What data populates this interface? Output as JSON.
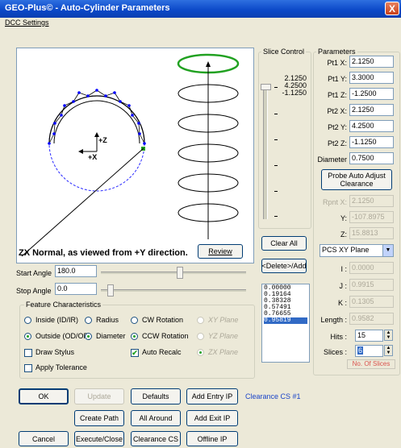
{
  "window": {
    "title": "GEO-Plus© - Auto-Cylinder Parameters",
    "close": "X"
  },
  "menu": {
    "dcc_settings": "DCC Settings"
  },
  "view": {
    "caption": "ZX Normal, as viewed from +Y direction.",
    "axis_z": "+Z",
    "axis_x": "+X",
    "review": "Review"
  },
  "angles": {
    "start_label": "Start Angle",
    "start_value": "180.0",
    "stop_label": "Stop Angle",
    "stop_value": "0.0"
  },
  "feature": {
    "title": "Feature Characteristics",
    "inside": "Inside (ID/IR)",
    "radius": "Radius",
    "cw": "CW Rotation",
    "xy_plane": "XY Plane",
    "outside": "Outside (OD/OR)",
    "diameter": "Diameter",
    "ccw": "CCW Rotation",
    "yz_plane": "YZ Plane",
    "draw_stylus": "Draw Stylus",
    "auto_recalc": "Auto Recalc",
    "zx_plane": "ZX Plane",
    "apply_tolerance": "Apply Tolerance"
  },
  "slice": {
    "title": "Slice Control",
    "v1": "2.1250",
    "v2": "4.2500",
    "v3": "-1.1250",
    "clear_all": "Clear All",
    "delete_add": "<Delete>/Add",
    "values": [
      "0.00000",
      "0.19164",
      "0.38328",
      "0.57491",
      "0.76655",
      "0.95819"
    ]
  },
  "params": {
    "title": "Parameters",
    "pt1x_label": "Pt1 X:",
    "pt1x": "2.1250",
    "pt1y_label": "Pt1 Y:",
    "pt1y": "3.3000",
    "pt1z_label": "Pt1 Z:",
    "pt1z": "-1.2500",
    "pt2x_label": "Pt2 X:",
    "pt2x": "2.1250",
    "pt2y_label": "Pt2 Y:",
    "pt2y": "4.2500",
    "pt2z_label": "Pt2 Z:",
    "pt2z": "-1.1250",
    "diam_label": "Diameter",
    "diam": "0.7500",
    "probe_btn": "Probe Auto Adjust Clearance",
    "rpntx_label": "Rpnt X:",
    "rpntx": "2.1250",
    "y_label": "Y:",
    "y": "-107.8975",
    "z_label": "Z:",
    "z": "15.8813",
    "plane_select": "PCS XY Plane",
    "i_label": "I :",
    "i": "0.0000",
    "j_label": "J :",
    "j": "0.9915",
    "k_label": "K :",
    "k": "0.1305",
    "length_label": "Length :",
    "length": "0.9582",
    "hits_label": "Hits :",
    "hits": "15",
    "slices_label": "Slices :",
    "slices": "6",
    "no_slices": "No. Of Slices"
  },
  "bottom": {
    "ok": "OK",
    "update": "Update",
    "defaults": "Defaults",
    "add_entry": "Add Entry IP",
    "clearance_cs_label": "Clearance CS #1",
    "create_path": "Create Path",
    "all_around": "All Around",
    "add_exit": "Add Exit IP",
    "cancel": "Cancel",
    "execute_close": "Execute/Close",
    "clearance_cs": "Clearance CS",
    "offline_ip": "Offline IP"
  },
  "colors": {
    "title_bar": "#0a47c7",
    "highlight_ring": "#21a121",
    "probe_points": "#0000ff",
    "hint_text": "#d9534f",
    "link_blue": "#1a44c8"
  }
}
